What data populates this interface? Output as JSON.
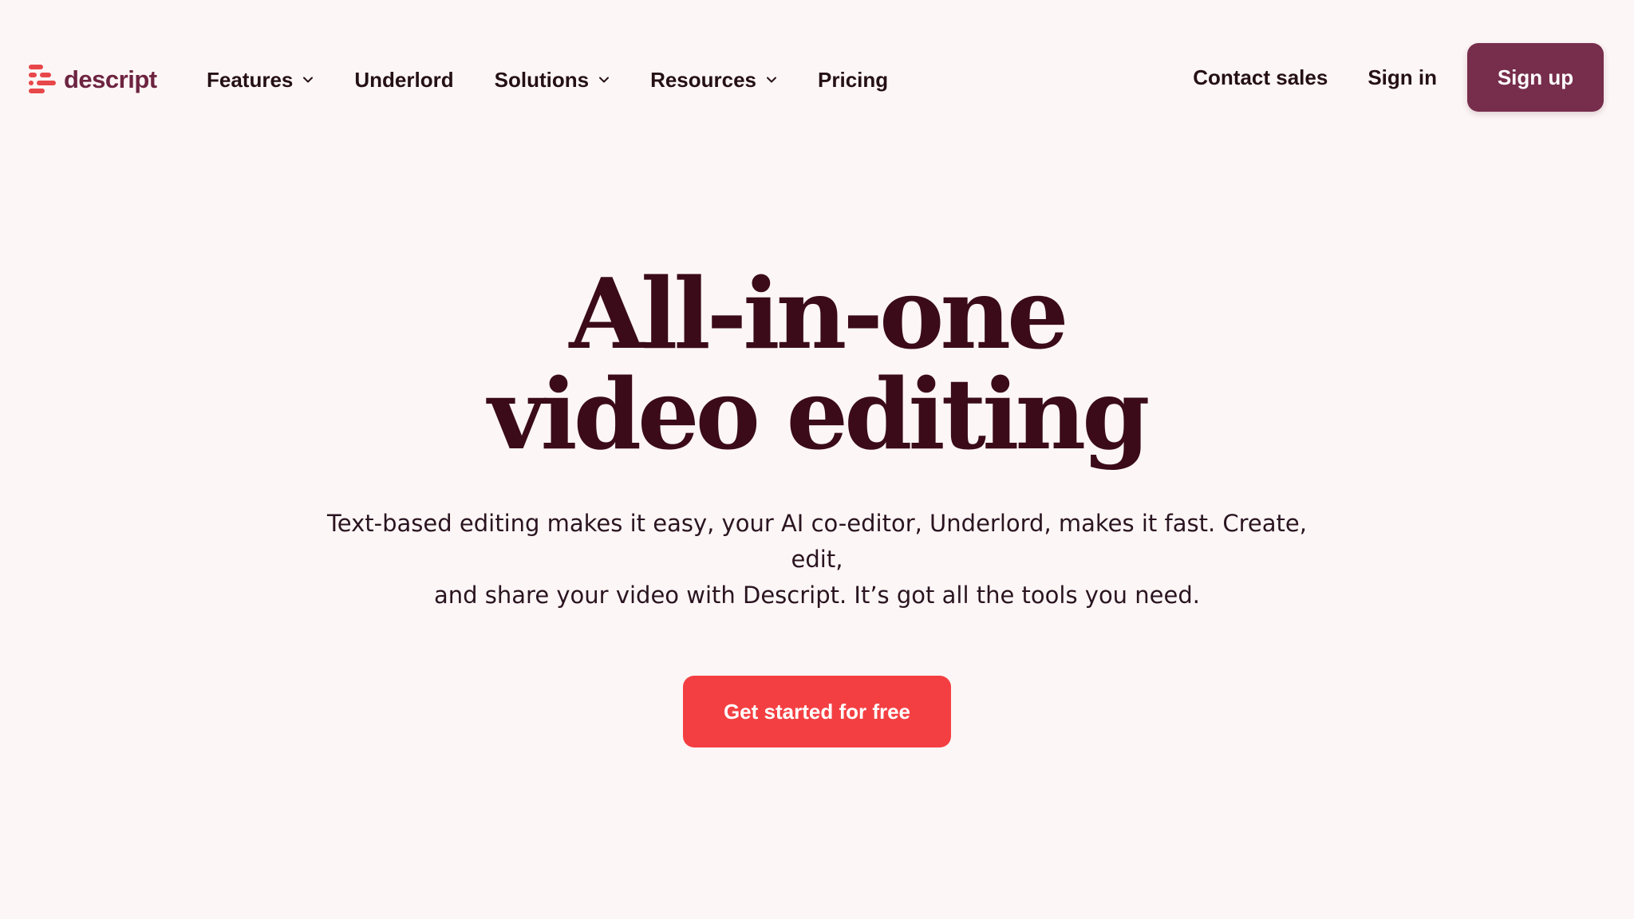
{
  "brand": {
    "name": "descript",
    "logo_icon": "descript-logo-icon",
    "logo_color": "#e8474a",
    "text_color": "#6d2440"
  },
  "nav": {
    "items": [
      {
        "label": "Features",
        "has_dropdown": true
      },
      {
        "label": "Underlord",
        "has_dropdown": false
      },
      {
        "label": "Solutions",
        "has_dropdown": true
      },
      {
        "label": "Resources",
        "has_dropdown": true
      },
      {
        "label": "Pricing",
        "has_dropdown": false
      }
    ],
    "contact_sales": "Contact sales",
    "sign_in": "Sign in",
    "sign_up": "Sign up",
    "sign_up_color": "#772d4c"
  },
  "hero": {
    "title_line1": "All-in-one",
    "title_line2": "video editing",
    "subtitle_line1": "Text-based editing makes it easy, your AI co-editor, Underlord, makes it fast. Create, edit,",
    "subtitle_line2": "and share your video with Descript. It’s got all the tools you need.",
    "cta_label": "Get started for free",
    "cta_color": "#f43f42"
  }
}
